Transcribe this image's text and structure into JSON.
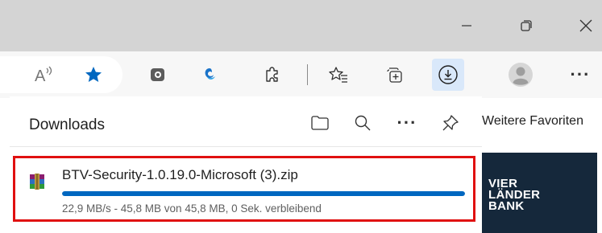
{
  "toolbar": {
    "icons": [
      "read-aloud-icon",
      "favorite-star-icon",
      "extension-icon",
      "edge-drop-icon",
      "extensions-puzzle-icon",
      "favorites-icon",
      "collections-icon",
      "downloads-icon",
      "profile-avatar-icon",
      "more-options-icon"
    ],
    "more_label": "···",
    "accent_color": "#0067c0"
  },
  "favorites_bar": {
    "label": "Weitere Favoriten"
  },
  "ad": {
    "logo_lines": [
      "VIER",
      "LÄNDER",
      "BANK"
    ]
  },
  "downloads": {
    "title": "Downloads",
    "header_icons": [
      "open-folder-icon",
      "search-icon",
      "more-icon",
      "pin-icon"
    ],
    "more_label": "···",
    "items": [
      {
        "filename": "BTV-Security-1.0.19.0-Microsoft (3).zip",
        "status": "22,9 MB/s - 45,8 MB von 45,8 MB, 0 Sek. verbleibend",
        "progress": 1.0,
        "icon": "winrar-archive-icon",
        "highlight_color": "#e01010"
      }
    ]
  }
}
